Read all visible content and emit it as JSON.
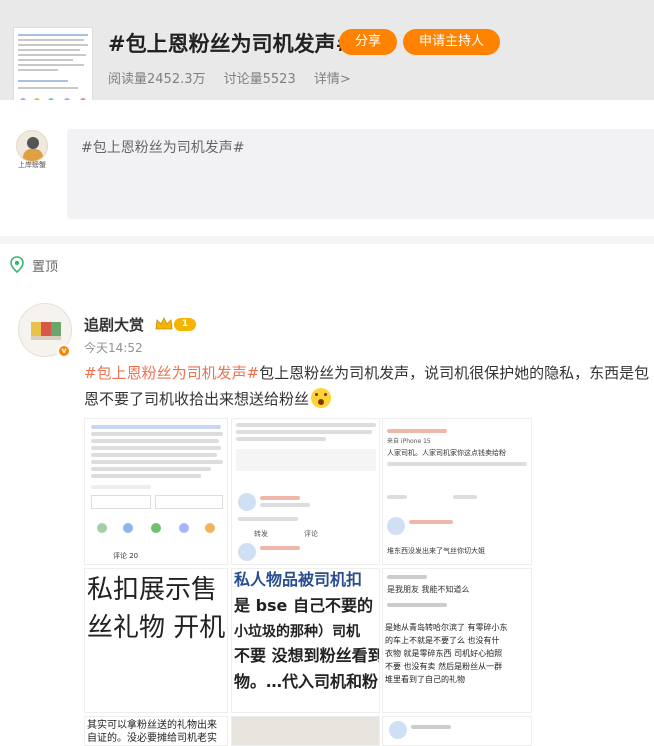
{
  "topic": {
    "title": "#包上恩粉丝为司机发声#",
    "share_label": "分享",
    "apply_host_label": "申请主持人",
    "reads": "阅读量2452.3万",
    "discussions": "讨论量5523",
    "details": "详情>"
  },
  "compose": {
    "user_name": "上岸螃蟹",
    "text": "#包上恩粉丝为司机发声#"
  },
  "pinned": {
    "label": "置顶"
  },
  "post": {
    "author": "追剧大赏",
    "level": "1",
    "time": "今天14:52",
    "tag": "#包上恩粉丝为司机发声#",
    "text_line1": "包上恩粉丝为司机发声，说司机很保护她的隐私，东西是包",
    "text_line2": "恩不要了司机收拾出来想送给粉丝",
    "images": {
      "img4_line1": "私扣展示售",
      "img4_line2": "丝礼物 开机",
      "img5_line1": "私人物品被司机扣",
      "img5_line2": "是 bse 自己不要的",
      "img5_line3": "小垃圾的那种）司机",
      "img5_line4": "不要 没想到粉丝看到",
      "img5_line5": "物。…代入司机和粉",
      "img1_comment_count": "评论 20",
      "img2_label": "转发",
      "img2_comment": "评论",
      "img3_from": "来自 iPhone 15",
      "img3_text": "人家司机。人家司机家你这点钱卖给粉",
      "img3_text2": "堆东西没发出来了气丝你切大姐",
      "img6_text1": "是我朋友 我能不知道么",
      "img6_text2": "是她从青岛转哈尔滨了 有零碎小东",
      "img6_text3": "的车上不就是不要了么 也没有什",
      "img6_text4": "衣物 就是零碎东西 司机好心拍照",
      "img6_text5": "不要 也没有卖 然后是粉丝从一群",
      "img6_text6": "堆里看到了自己的礼物",
      "img7_text1": "其实可以拿粉丝送的礼物出来",
      "img7_text2": "自证的。没必要摊给司机老实"
    }
  },
  "colors": {
    "accent": "#ff8200",
    "tag": "#eb7350",
    "header_bg": "#e9e9e9"
  }
}
